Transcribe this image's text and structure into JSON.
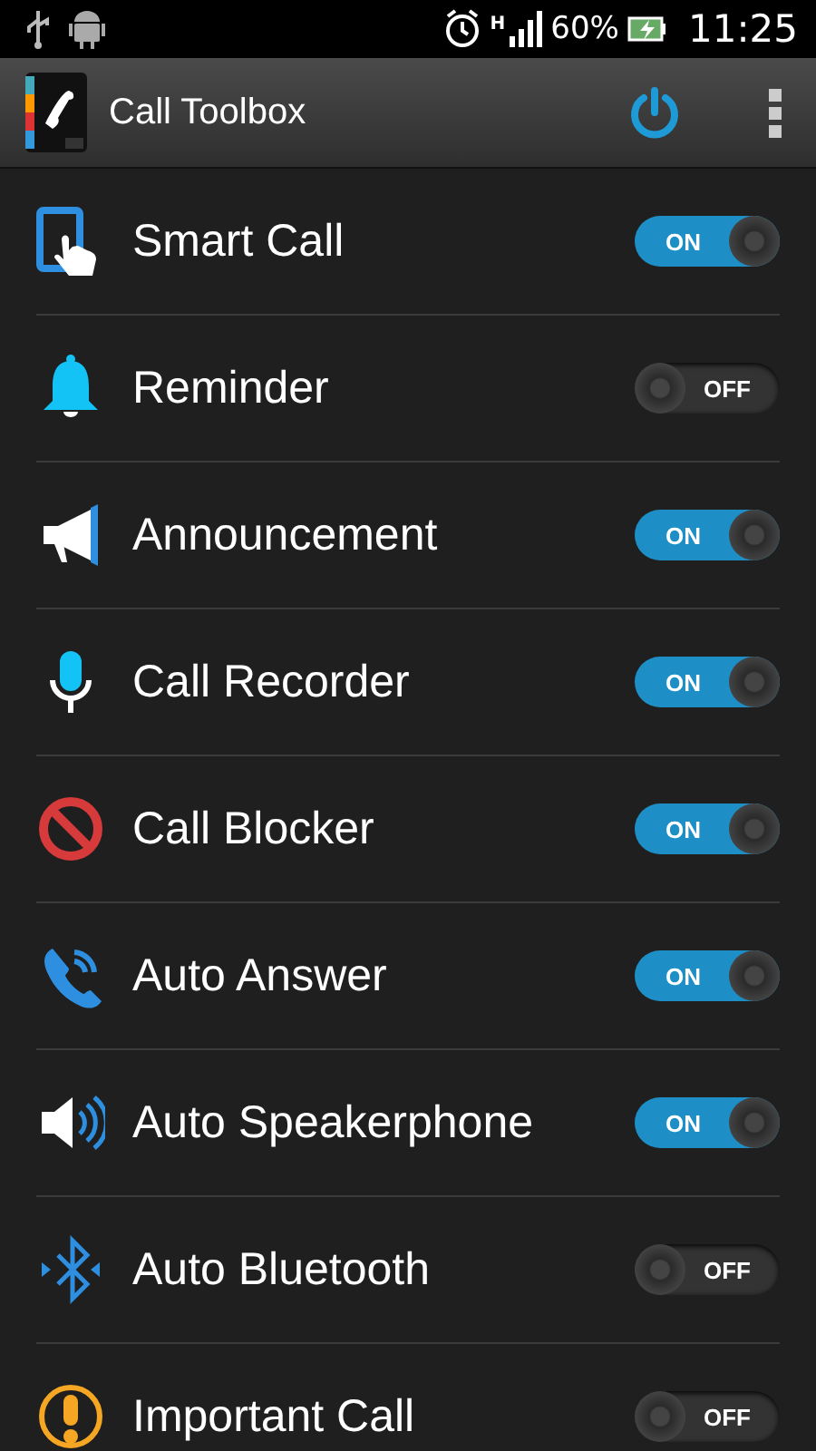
{
  "status_bar": {
    "battery": "60%",
    "time": "11:25",
    "network": "H"
  },
  "app_bar": {
    "title": "Call Toolbox"
  },
  "features": [
    {
      "kind": "touch",
      "label": "Smart Call",
      "on": true,
      "switch_text": "ON"
    },
    {
      "kind": "bell",
      "label": "Reminder",
      "on": false,
      "switch_text": "OFF"
    },
    {
      "kind": "megaphone",
      "label": "Announcement",
      "on": true,
      "switch_text": "ON"
    },
    {
      "kind": "mic",
      "label": "Call Recorder",
      "on": true,
      "switch_text": "ON"
    },
    {
      "kind": "block",
      "label": "Call Blocker",
      "on": true,
      "switch_text": "ON"
    },
    {
      "kind": "phone",
      "label": "Auto Answer",
      "on": true,
      "switch_text": "ON"
    },
    {
      "kind": "speaker",
      "label": "Auto Speakerphone",
      "on": true,
      "switch_text": "ON"
    },
    {
      "kind": "bluetooth",
      "label": "Auto Bluetooth",
      "on": false,
      "switch_text": "OFF"
    },
    {
      "kind": "alert",
      "label": "Important Call",
      "on": false,
      "switch_text": "OFF"
    }
  ]
}
